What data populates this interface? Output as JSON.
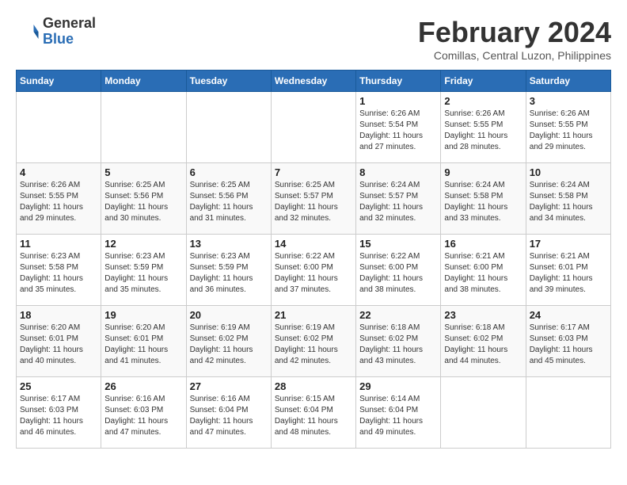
{
  "header": {
    "logo_line1": "General",
    "logo_line2": "Blue",
    "month_title": "February 2024",
    "subtitle": "Comillas, Central Luzon, Philippines"
  },
  "days_of_week": [
    "Sunday",
    "Monday",
    "Tuesday",
    "Wednesday",
    "Thursday",
    "Friday",
    "Saturday"
  ],
  "weeks": [
    [
      {
        "day": "",
        "sunrise": "",
        "sunset": "",
        "daylight": ""
      },
      {
        "day": "",
        "sunrise": "",
        "sunset": "",
        "daylight": ""
      },
      {
        "day": "",
        "sunrise": "",
        "sunset": "",
        "daylight": ""
      },
      {
        "day": "",
        "sunrise": "",
        "sunset": "",
        "daylight": ""
      },
      {
        "day": "1",
        "sunrise": "Sunrise: 6:26 AM",
        "sunset": "Sunset: 5:54 PM",
        "daylight": "Daylight: 11 hours and 27 minutes."
      },
      {
        "day": "2",
        "sunrise": "Sunrise: 6:26 AM",
        "sunset": "Sunset: 5:55 PM",
        "daylight": "Daylight: 11 hours and 28 minutes."
      },
      {
        "day": "3",
        "sunrise": "Sunrise: 6:26 AM",
        "sunset": "Sunset: 5:55 PM",
        "daylight": "Daylight: 11 hours and 29 minutes."
      }
    ],
    [
      {
        "day": "4",
        "sunrise": "Sunrise: 6:26 AM",
        "sunset": "Sunset: 5:55 PM",
        "daylight": "Daylight: 11 hours and 29 minutes."
      },
      {
        "day": "5",
        "sunrise": "Sunrise: 6:25 AM",
        "sunset": "Sunset: 5:56 PM",
        "daylight": "Daylight: 11 hours and 30 minutes."
      },
      {
        "day": "6",
        "sunrise": "Sunrise: 6:25 AM",
        "sunset": "Sunset: 5:56 PM",
        "daylight": "Daylight: 11 hours and 31 minutes."
      },
      {
        "day": "7",
        "sunrise": "Sunrise: 6:25 AM",
        "sunset": "Sunset: 5:57 PM",
        "daylight": "Daylight: 11 hours and 32 minutes."
      },
      {
        "day": "8",
        "sunrise": "Sunrise: 6:24 AM",
        "sunset": "Sunset: 5:57 PM",
        "daylight": "Daylight: 11 hours and 32 minutes."
      },
      {
        "day": "9",
        "sunrise": "Sunrise: 6:24 AM",
        "sunset": "Sunset: 5:58 PM",
        "daylight": "Daylight: 11 hours and 33 minutes."
      },
      {
        "day": "10",
        "sunrise": "Sunrise: 6:24 AM",
        "sunset": "Sunset: 5:58 PM",
        "daylight": "Daylight: 11 hours and 34 minutes."
      }
    ],
    [
      {
        "day": "11",
        "sunrise": "Sunrise: 6:23 AM",
        "sunset": "Sunset: 5:58 PM",
        "daylight": "Daylight: 11 hours and 35 minutes."
      },
      {
        "day": "12",
        "sunrise": "Sunrise: 6:23 AM",
        "sunset": "Sunset: 5:59 PM",
        "daylight": "Daylight: 11 hours and 35 minutes."
      },
      {
        "day": "13",
        "sunrise": "Sunrise: 6:23 AM",
        "sunset": "Sunset: 5:59 PM",
        "daylight": "Daylight: 11 hours and 36 minutes."
      },
      {
        "day": "14",
        "sunrise": "Sunrise: 6:22 AM",
        "sunset": "Sunset: 6:00 PM",
        "daylight": "Daylight: 11 hours and 37 minutes."
      },
      {
        "day": "15",
        "sunrise": "Sunrise: 6:22 AM",
        "sunset": "Sunset: 6:00 PM",
        "daylight": "Daylight: 11 hours and 38 minutes."
      },
      {
        "day": "16",
        "sunrise": "Sunrise: 6:21 AM",
        "sunset": "Sunset: 6:00 PM",
        "daylight": "Daylight: 11 hours and 38 minutes."
      },
      {
        "day": "17",
        "sunrise": "Sunrise: 6:21 AM",
        "sunset": "Sunset: 6:01 PM",
        "daylight": "Daylight: 11 hours and 39 minutes."
      }
    ],
    [
      {
        "day": "18",
        "sunrise": "Sunrise: 6:20 AM",
        "sunset": "Sunset: 6:01 PM",
        "daylight": "Daylight: 11 hours and 40 minutes."
      },
      {
        "day": "19",
        "sunrise": "Sunrise: 6:20 AM",
        "sunset": "Sunset: 6:01 PM",
        "daylight": "Daylight: 11 hours and 41 minutes."
      },
      {
        "day": "20",
        "sunrise": "Sunrise: 6:19 AM",
        "sunset": "Sunset: 6:02 PM",
        "daylight": "Daylight: 11 hours and 42 minutes."
      },
      {
        "day": "21",
        "sunrise": "Sunrise: 6:19 AM",
        "sunset": "Sunset: 6:02 PM",
        "daylight": "Daylight: 11 hours and 42 minutes."
      },
      {
        "day": "22",
        "sunrise": "Sunrise: 6:18 AM",
        "sunset": "Sunset: 6:02 PM",
        "daylight": "Daylight: 11 hours and 43 minutes."
      },
      {
        "day": "23",
        "sunrise": "Sunrise: 6:18 AM",
        "sunset": "Sunset: 6:02 PM",
        "daylight": "Daylight: 11 hours and 44 minutes."
      },
      {
        "day": "24",
        "sunrise": "Sunrise: 6:17 AM",
        "sunset": "Sunset: 6:03 PM",
        "daylight": "Daylight: 11 hours and 45 minutes."
      }
    ],
    [
      {
        "day": "25",
        "sunrise": "Sunrise: 6:17 AM",
        "sunset": "Sunset: 6:03 PM",
        "daylight": "Daylight: 11 hours and 46 minutes."
      },
      {
        "day": "26",
        "sunrise": "Sunrise: 6:16 AM",
        "sunset": "Sunset: 6:03 PM",
        "daylight": "Daylight: 11 hours and 47 minutes."
      },
      {
        "day": "27",
        "sunrise": "Sunrise: 6:16 AM",
        "sunset": "Sunset: 6:04 PM",
        "daylight": "Daylight: 11 hours and 47 minutes."
      },
      {
        "day": "28",
        "sunrise": "Sunrise: 6:15 AM",
        "sunset": "Sunset: 6:04 PM",
        "daylight": "Daylight: 11 hours and 48 minutes."
      },
      {
        "day": "29",
        "sunrise": "Sunrise: 6:14 AM",
        "sunset": "Sunset: 6:04 PM",
        "daylight": "Daylight: 11 hours and 49 minutes."
      },
      {
        "day": "",
        "sunrise": "",
        "sunset": "",
        "daylight": ""
      },
      {
        "day": "",
        "sunrise": "",
        "sunset": "",
        "daylight": ""
      }
    ]
  ]
}
